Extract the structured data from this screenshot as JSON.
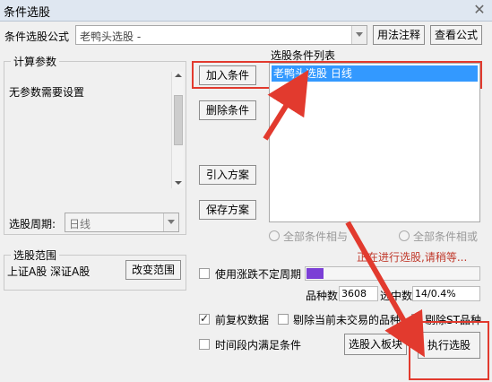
{
  "window": {
    "title": "条件选股"
  },
  "formula": {
    "label": "条件选股公式",
    "value": "老鸭头选股    -",
    "usage_button": "用法注释",
    "view_button": "查看公式"
  },
  "params": {
    "group_label": "计算参数",
    "text": "无参数需要设置",
    "period_label": "选股周期:",
    "period_value": "日线"
  },
  "buttons": {
    "add": "加入条件",
    "delete": "删除条件",
    "import": "引入方案",
    "save": "保存方案"
  },
  "condition_list": {
    "label": "选股条件列表",
    "items": [
      "老鸭头选股    日线"
    ]
  },
  "logic": {
    "all_and": "全部条件相与",
    "all_or": "全部条件相或"
  },
  "status": {
    "text": "正在进行选股,请稍等...",
    "progress": 0.1
  },
  "range": {
    "group_label": "选股范围",
    "markets": "上证A股 深证A股",
    "change_button": "改变范围"
  },
  "options": {
    "use_irregular_period": "使用涨跌不定周期",
    "pre_adjust": "前复权数据",
    "exclude_untraded": "剔除当前未交易的品种",
    "exclude_st": "剔除ST品种",
    "time_range": "时间段内满足条件"
  },
  "stats": {
    "count_label": "品种数",
    "count_value": "3608",
    "selected_label": "选中数",
    "selected_value": "14/0.4%"
  },
  "actions": {
    "to_block": "选股入板块",
    "execute": "执行选股"
  },
  "colors": {
    "accent_red": "#e23a2e",
    "progress": "#7b3fd6",
    "highlight": "#3399ff",
    "status_text": "#c0392b"
  }
}
